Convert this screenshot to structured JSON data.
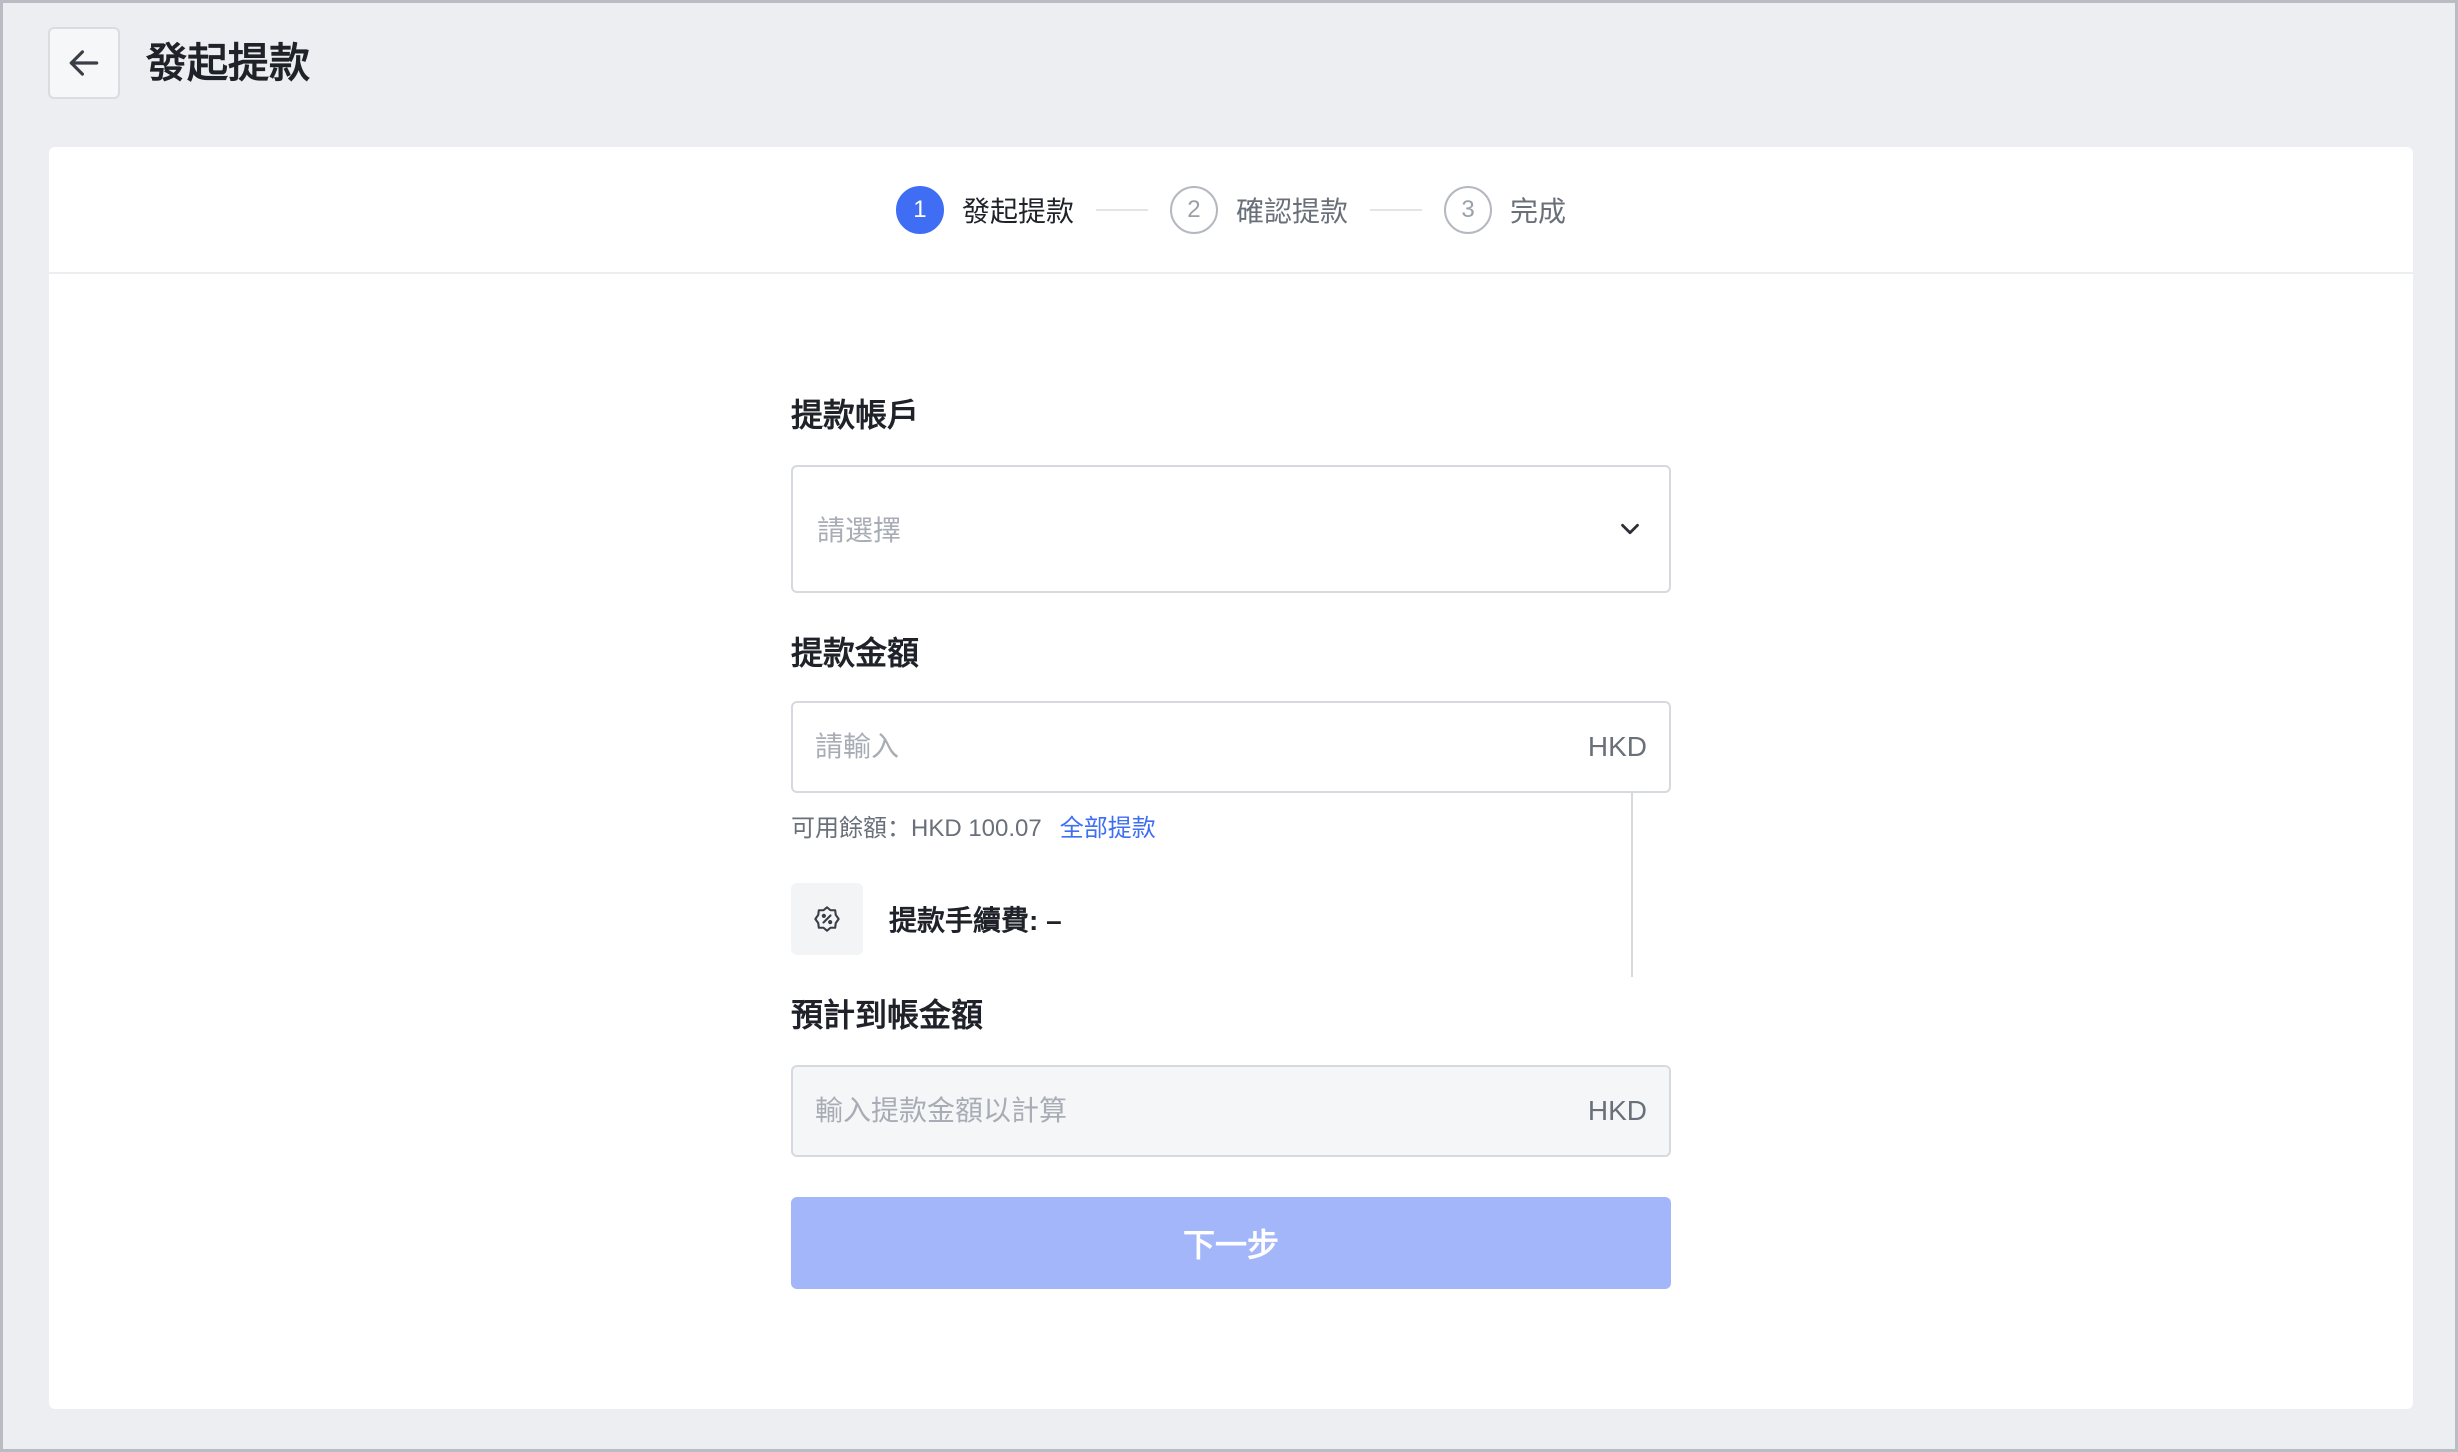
{
  "header": {
    "title": "發起提款",
    "back_icon": "arrow-left-icon"
  },
  "steps": [
    {
      "number": "1",
      "label": "發起提款",
      "active": true
    },
    {
      "number": "2",
      "label": "確認提款",
      "active": false
    },
    {
      "number": "3",
      "label": "完成",
      "active": false
    }
  ],
  "form": {
    "account_label": "提款帳戶",
    "account_placeholder": "請選擇",
    "amount_label": "提款金額",
    "amount_placeholder": "請輸入",
    "amount_currency": "HKD",
    "balance_text": "可用餘額：HKD 100.07",
    "withdraw_all": "全部提款",
    "fee_text": "提款手續費: –",
    "fee_icon": "settings-icon",
    "expected_label": "預計到帳金額",
    "expected_placeholder": "輸入提款金額以計算",
    "expected_currency": "HKD",
    "next_button": "下一步"
  },
  "colors": {
    "primary": "#3f6ef5",
    "button_disabled": "#a3b6fa",
    "background": "#edeef1"
  }
}
